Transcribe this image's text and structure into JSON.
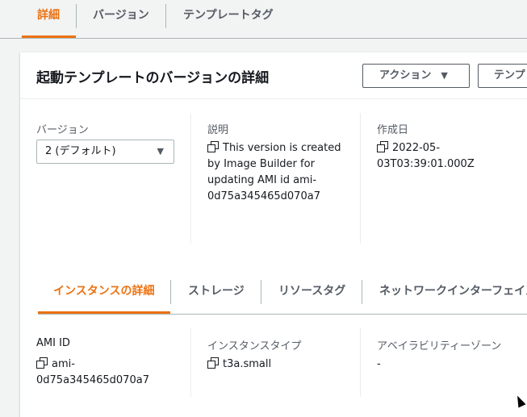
{
  "top_tabs": [
    {
      "label": "詳細",
      "active": true
    },
    {
      "label": "バージョン",
      "active": false
    },
    {
      "label": "テンプレートタグ",
      "active": false
    }
  ],
  "panel": {
    "title": "起動テンプレートのバージョンの詳細",
    "actions_button": "アクション",
    "template_button": "テンプ"
  },
  "details": {
    "version_label": "バージョン",
    "version_value": "2 (デフォルト)",
    "description_label": "説明",
    "description_lines": [
      "This version is created",
      "by Image Builder for",
      "updating AMI id ami-",
      "0d75a345465d070a7"
    ],
    "created_label": "作成日",
    "created_lines": [
      "2022-05-",
      "03T03:39:01.000Z"
    ]
  },
  "sub_tabs": [
    {
      "label": "インスタンスの詳細",
      "active": true
    },
    {
      "label": "ストレージ",
      "active": false
    },
    {
      "label": "リソースタグ",
      "active": false
    },
    {
      "label": "ネットワークインターフェイス",
      "active": false
    }
  ],
  "instance": {
    "ami_label": "AMI ID",
    "ami_lines": [
      "ami-",
      "0d75a345465d070a7"
    ],
    "type_label": "インスタンスタイプ",
    "type_value": "t3a.small",
    "az_label": "アベイラビリティーゾーン",
    "az_value": "-"
  },
  "colors": {
    "accent": "#ec7211",
    "text": "#16191f",
    "muted": "#545b64",
    "border": "#aab7b8"
  }
}
